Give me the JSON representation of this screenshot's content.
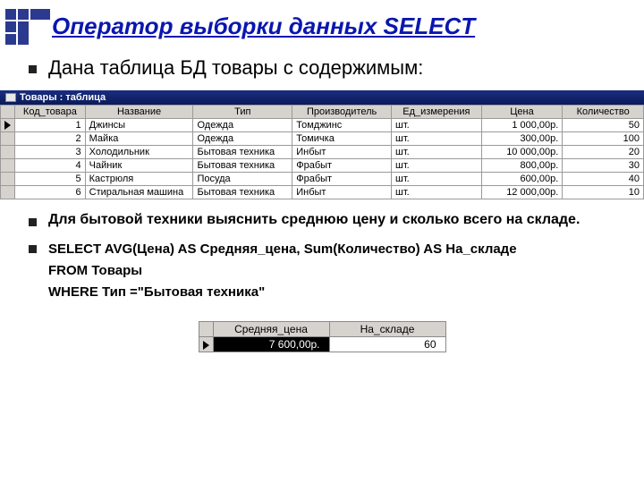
{
  "title": "Оператор выборки данных SELECT",
  "lead": "Дана таблица БД товары с содержимым:",
  "window_caption": "Товары : таблица",
  "table": {
    "headers": [
      "Код_товара",
      "Название",
      "Тип",
      "Производитель",
      "Ед_измерения",
      "Цена",
      "Количество"
    ],
    "rows": [
      {
        "id": "1",
        "name": "Джинсы",
        "type": "Одежда",
        "maker": "Томджинс",
        "unit": "шт.",
        "price": "1 000,00р.",
        "qty": "50"
      },
      {
        "id": "2",
        "name": "Майка",
        "type": "Одежда",
        "maker": "Томичка",
        "unit": "шт.",
        "price": "300,00р.",
        "qty": "100"
      },
      {
        "id": "3",
        "name": "Холодильник",
        "type": "Бытовая техника",
        "maker": "Инбыт",
        "unit": "шт.",
        "price": "10 000,00р.",
        "qty": "20"
      },
      {
        "id": "4",
        "name": "Чайник",
        "type": "Бытовая техника",
        "maker": "Фрабыт",
        "unit": "шт.",
        "price": "800,00р.",
        "qty": "30"
      },
      {
        "id": "5",
        "name": "Кастрюля",
        "type": "Посуда",
        "maker": "Фрабыт",
        "unit": "шт.",
        "price": "600,00р.",
        "qty": "40"
      },
      {
        "id": "6",
        "name": "Стиральная машина",
        "type": "Бытовая техника",
        "maker": "Инбыт",
        "unit": "шт.",
        "price": "12 000,00р.",
        "qty": "10"
      }
    ]
  },
  "task": "Для бытовой техники выяснить среднюю цену и сколько всего на складе.",
  "sql": {
    "line1": "SELECT AVG(Цена) AS Средняя_цена, Sum(Количество) AS На_складе",
    "line2": "FROM Товары",
    "line3": "WHERE Тип =\"Бытовая техника\""
  },
  "result": {
    "headers": [
      "Средняя_цена",
      "На_складе"
    ],
    "avg": "7 600,00р.",
    "total": "60"
  }
}
